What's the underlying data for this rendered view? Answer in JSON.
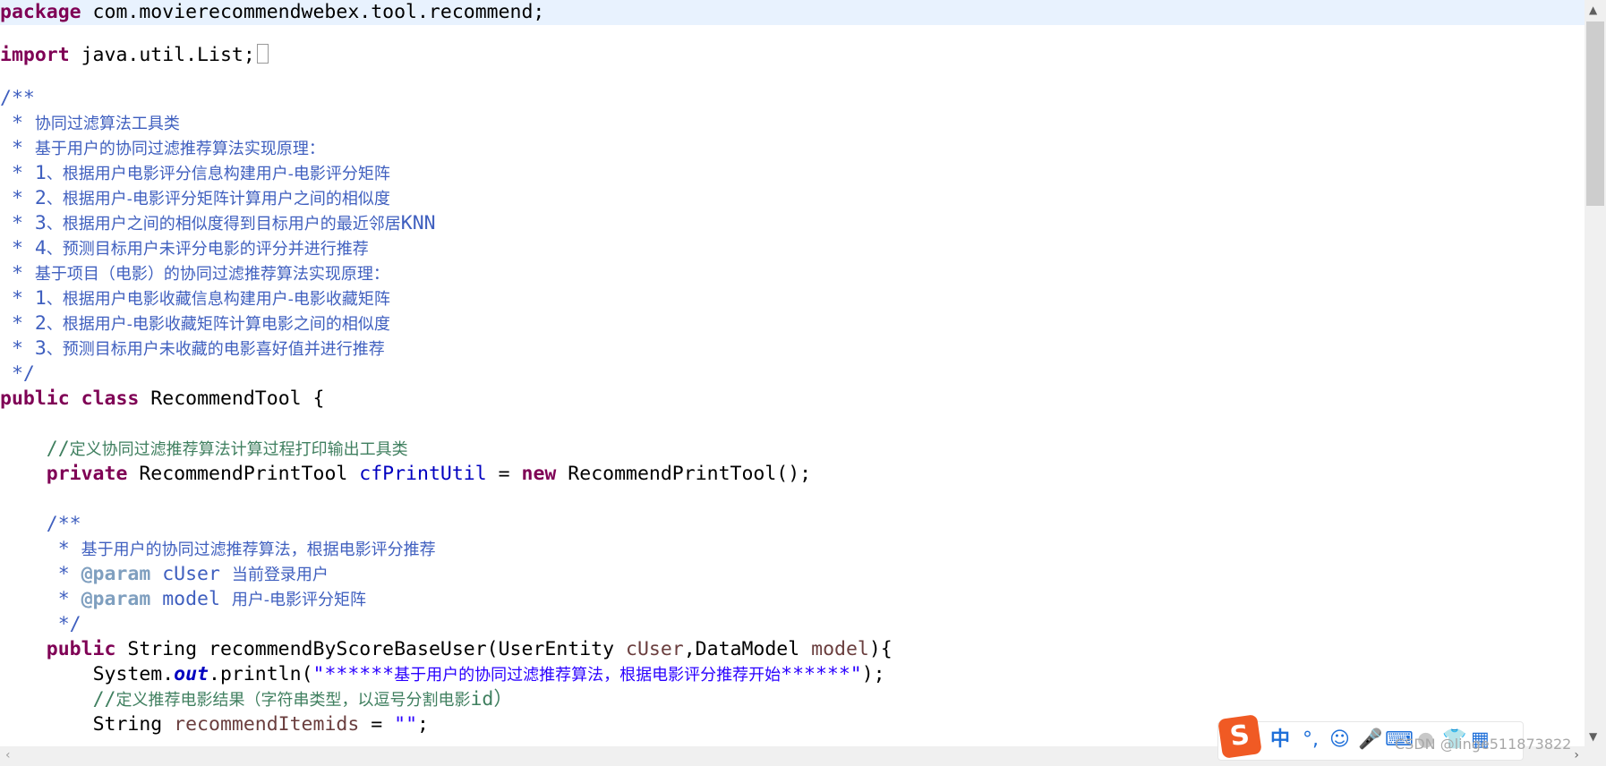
{
  "editor": {
    "package_kw": "package",
    "package_name": " com.movierecommendwebex.tool.recommend;",
    "import_kw": "import",
    "import_name": " java.util.List;",
    "jd_open": "/**",
    "jd_l1_star": " * ",
    "jd_l1": "协同过滤算法工具类",
    "jd_l2": "基于用户的协同过滤推荐算法实现原理：",
    "jd_l3_num": "1",
    "jd_l3": "、根据用户电影评分信息构建用户-电影评分矩阵",
    "jd_l4_num": "2",
    "jd_l4": "、根据用户-电影评分矩阵计算用户之间的相似度",
    "jd_l5_num": "3",
    "jd_l5": "、根据用户之间的相似度得到目标用户的最近邻居",
    "jd_l5_tail": "KNN",
    "jd_l6_num": "4",
    "jd_l6": "、预测目标用户未评分电影的评分并进行推荐",
    "jd_l7": "基于项目（电影）的协同过滤推荐算法实现原理：",
    "jd_l8_num": "1",
    "jd_l8": "、根据用户电影收藏信息构建用户-电影收藏矩阵",
    "jd_l9_num": "2",
    "jd_l9": "、根据用户-电影收藏矩阵计算电影之间的相似度",
    "jd_l10_num": "3",
    "jd_l10": "、预测目标用户未收藏的电影喜好值并进行推荐",
    "jd_close": " */",
    "class_public": "public",
    "class_kw": "class",
    "class_name": " RecommendTool {",
    "comment1_slash": "//",
    "comment1": "定义协同过滤推荐算法计算过程打印输出工具类",
    "field_private": "private",
    "field_type": " RecommendPrintTool ",
    "field_name": "cfPrintUtil",
    "field_eq": " = ",
    "field_new": "new",
    "field_init": " RecommendPrintTool();",
    "mjd_open": "/**",
    "mjd_l1": "基于用户的协同过滤推荐算法，根据电影评分推荐",
    "mjd_param_tag": "@param",
    "mjd_param1_name": " cUser ",
    "mjd_param1_desc": "当前登录用户",
    "mjd_param2_name": " model ",
    "mjd_param2_desc": "用户-电影评分矩阵",
    "mjd_close": " */",
    "method_public": "public",
    "method_sig_a": " String recommendByScoreBaseUser(UserEntity ",
    "method_p1": "cUser",
    "method_sig_b": ",DataModel ",
    "method_p2": "model",
    "method_sig_c": "){",
    "println_a": "System.",
    "println_out": "out",
    "println_b": ".println(",
    "println_str_a": "\"******",
    "println_str_cn": "基于用户的协同过滤推荐算法，根据电影评分推荐开始",
    "println_str_b": "******\"",
    "println_c": ");",
    "comment2_slash": "//",
    "comment2": "定义推荐电影结果（字符串类型，以逗号分割电影",
    "comment2_tail": "id）",
    "last_type": "String ",
    "last_var": "recommendItemids",
    "last_eq": " = ",
    "last_str": "\"\"",
    "last_end": ";"
  },
  "ime": {
    "logo": "S",
    "lang": "中",
    "punct": "°,",
    "emoji": "☺",
    "mic": "🎤",
    "keyboard": "⌨",
    "user": "●",
    "shirt": "👕",
    "grid": "▦"
  },
  "watermark": "CSDN @linge511873822"
}
